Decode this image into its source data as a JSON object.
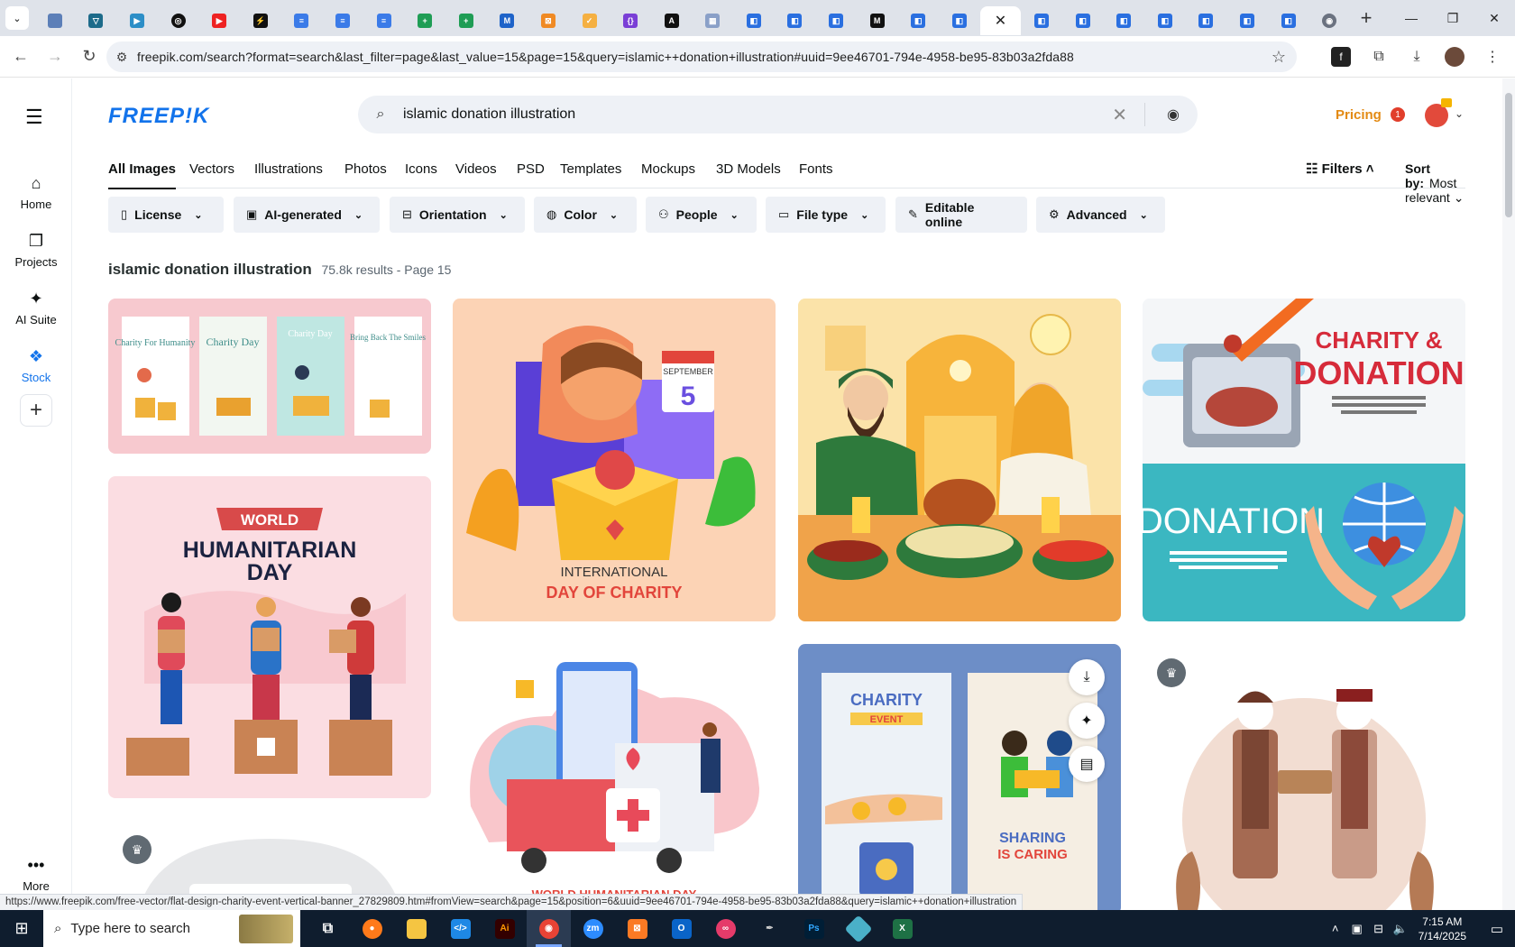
{
  "browser": {
    "url": "freepik.com/search?format=search&last_filter=page&last_value=15&page=15&query=islamic++donation+illustration#uuid=9ee46701-794e-4958-be95-83b03a2fda88",
    "status_url": "https://www.freepik.com/free-vector/flat-design-charity-event-vertical-banner_27829809.htm#fromView=search&page=15&position=6&uuid=9ee46701-794e-4958-be95-83b03a2fda88&query=islamic++donation+illustration"
  },
  "header": {
    "logo": "FREEP!K",
    "search_value": "islamic  donation illustration",
    "pricing": "Pricing",
    "notification_count": "1"
  },
  "sidebar": {
    "items": [
      {
        "label": "Home"
      },
      {
        "label": "Projects"
      },
      {
        "label": "AI Suite"
      },
      {
        "label": "Stock"
      }
    ],
    "more": "More"
  },
  "type_tabs": [
    "All Images",
    "Vectors",
    "Illustrations",
    "Photos",
    "Icons",
    "Videos",
    "PSD",
    "Templates",
    "Mockups",
    "3D Models",
    "Fonts"
  ],
  "filters_label": "Filters",
  "sort": {
    "label": "Sort by:",
    "value": "Most relevant"
  },
  "chips": [
    "License",
    "AI-generated",
    "Orientation",
    "Color",
    "People",
    "File type",
    "Editable online",
    "Advanced"
  ],
  "results": {
    "query": "islamic donation illustration",
    "count": "75.8k results - Page 15"
  },
  "cards": {
    "banners": [
      "Charity For Humanity",
      "Charity Day",
      "Charity Day",
      "Bring Back The Smiles"
    ],
    "humanitarian_world": "WORLD",
    "humanitarian_title": "HUMANITARIAN",
    "humanitarian_day": "DAY",
    "intl_month": "SEPTEMBER",
    "intl_day_num": "5",
    "intl_line1": "INTERNATIONAL",
    "intl_line2": "DAY OF CHARITY",
    "whd_caption": "WORLD HUMANITARIAN DAY",
    "charity_title1": "CHARITY &",
    "charity_title2": "DONATION",
    "donation_label": "DONATION",
    "event_title": "CHARITY",
    "event_sub": "EVENT",
    "sharing1": "SHARING",
    "sharing2": "IS CARING"
  },
  "taskbar": {
    "search_placeholder": "Type here to search",
    "time": "7:15 AM",
    "date": "7/14/2025"
  },
  "colors": {
    "brand": "#1273eb",
    "pricing": "#e38a13"
  }
}
